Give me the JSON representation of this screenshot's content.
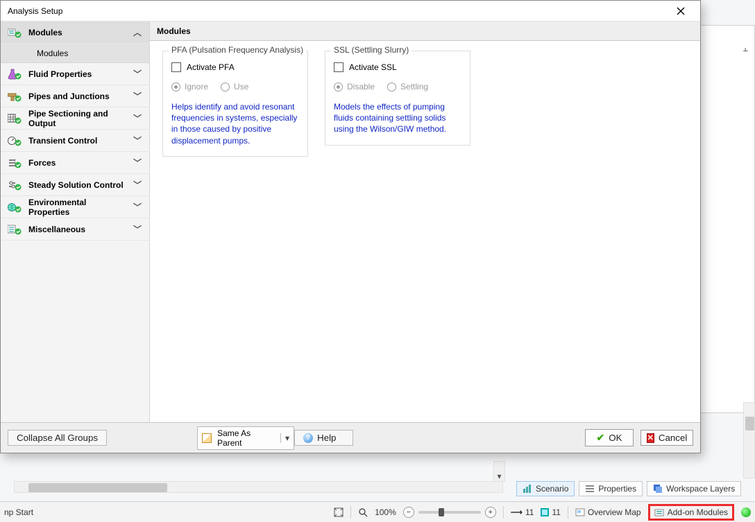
{
  "dialog": {
    "title": "Analysis Setup",
    "nav": [
      {
        "label": "Modules",
        "kind": "group",
        "expanded": true,
        "selected": true,
        "icon": "modules",
        "children": [
          {
            "label": "Modules",
            "selected": true
          }
        ]
      },
      {
        "label": "Fluid Properties",
        "kind": "group",
        "expanded": false,
        "icon": "flask"
      },
      {
        "label": "Pipes and Junctions",
        "kind": "group",
        "expanded": false,
        "icon": "pipes"
      },
      {
        "label": "Pipe Sectioning and Output",
        "kind": "group",
        "expanded": false,
        "icon": "grid"
      },
      {
        "label": "Transient Control",
        "kind": "group",
        "expanded": false,
        "icon": "dial"
      },
      {
        "label": "Forces",
        "kind": "group",
        "expanded": false,
        "icon": "forces"
      },
      {
        "label": "Steady Solution Control",
        "kind": "group",
        "expanded": false,
        "icon": "tune"
      },
      {
        "label": "Environmental Properties",
        "kind": "group",
        "expanded": false,
        "icon": "globe"
      },
      {
        "label": "Miscellaneous",
        "kind": "group",
        "expanded": false,
        "icon": "list"
      }
    ],
    "content": {
      "heading": "Modules",
      "pfa": {
        "legend": "PFA (Pulsation Frequency Analysis)",
        "checkbox_label": "Activate PFA",
        "checked": false,
        "radios": [
          {
            "label": "Ignore",
            "checked": true
          },
          {
            "label": "Use",
            "checked": false
          }
        ],
        "description": "Helps identify and avoid resonant frequencies in systems, especially in those caused by positive displacement pumps."
      },
      "ssl": {
        "legend": "SSL (Settling Slurry)",
        "checkbox_label": "Activate SSL",
        "checked": false,
        "radios": [
          {
            "label": "Disable",
            "checked": true
          },
          {
            "label": "Settling",
            "checked": false
          }
        ],
        "description": "Models the effects of pumping fluids containing settling solids using the Wilson/GIW method."
      }
    },
    "footer": {
      "collapse": "Collapse All Groups",
      "same_as_parent": "Same As Parent",
      "help": "Help",
      "ok": "OK",
      "cancel": "Cancel"
    }
  },
  "workspace": {
    "tabs": [
      {
        "label": "Scenario",
        "icon": "scenario",
        "active": true
      },
      {
        "label": "Properties",
        "icon": "props",
        "active": false
      },
      {
        "label": "Workspace Layers",
        "icon": "layers",
        "active": false
      }
    ]
  },
  "status": {
    "left_label": "np Start",
    "zoom_pct": "100%",
    "pipe_count": "11",
    "junction_count": "11",
    "overview": "Overview Map",
    "addon": "Add-on Modules"
  }
}
